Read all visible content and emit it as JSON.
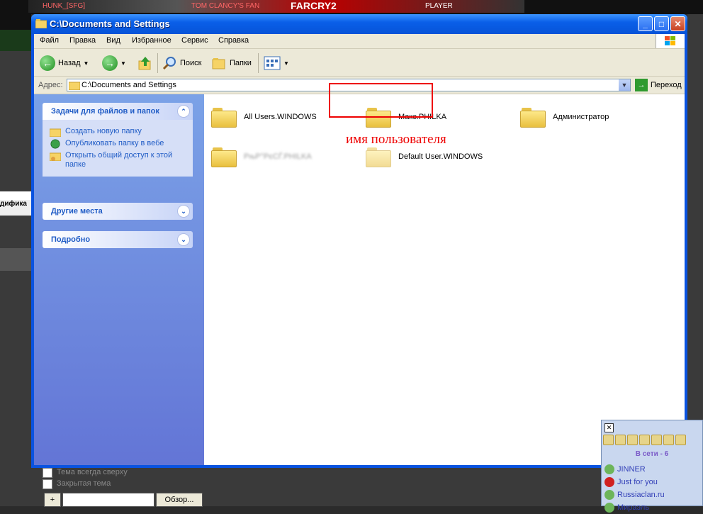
{
  "background": {
    "banner": [
      "HUNK_[SFG]",
      "TOM CLANCY'S FAN",
      "FARCRY2",
      "PLAYER"
    ],
    "left_fragment": "дифика",
    "bottom": {
      "checkbox1": "Тема всегда сверху",
      "checkbox2": "Закрытая тема",
      "add_btn": "+",
      "browse_btn": "Обзор..."
    }
  },
  "window": {
    "title": "C:\\Documents and Settings",
    "buttons": {
      "minimize": "_",
      "maximize": "□",
      "close": "✕"
    }
  },
  "menu": [
    "Файл",
    "Правка",
    "Вид",
    "Избранное",
    "Сервис",
    "Справка"
  ],
  "toolbar": {
    "back": "Назад",
    "search": "Поиск",
    "folders": "Папки"
  },
  "address": {
    "label": "Адрес:",
    "value": "C:\\Documents and Settings",
    "go": "Переход"
  },
  "sidebar": {
    "tasks": {
      "title": "Задачи для файлов и папок",
      "items": [
        "Создать новую папку",
        "Опубликовать папку в вебе",
        "Открыть общий доступ к этой папке"
      ]
    },
    "other": {
      "title": "Другие места"
    },
    "details": {
      "title": "Подробно"
    }
  },
  "folders": [
    {
      "name": "All Users.WINDOWS"
    },
    {
      "name": "Макс.PHILKA"
    },
    {
      "name": "Администратор"
    },
    {
      "name": "РњР°РєСЃ.PHILKA"
    },
    {
      "name": "Default User.WINDOWS"
    }
  ],
  "annotation": "имя пользователя",
  "chat": {
    "online": "В сети - 6",
    "users": [
      "JINNER",
      "Just for you",
      "Russiaclan.ru",
      "Мираэль"
    ]
  },
  "colors": {
    "accent": "#0a53e0",
    "annotation": "#e00000",
    "link": "#215dc6"
  }
}
